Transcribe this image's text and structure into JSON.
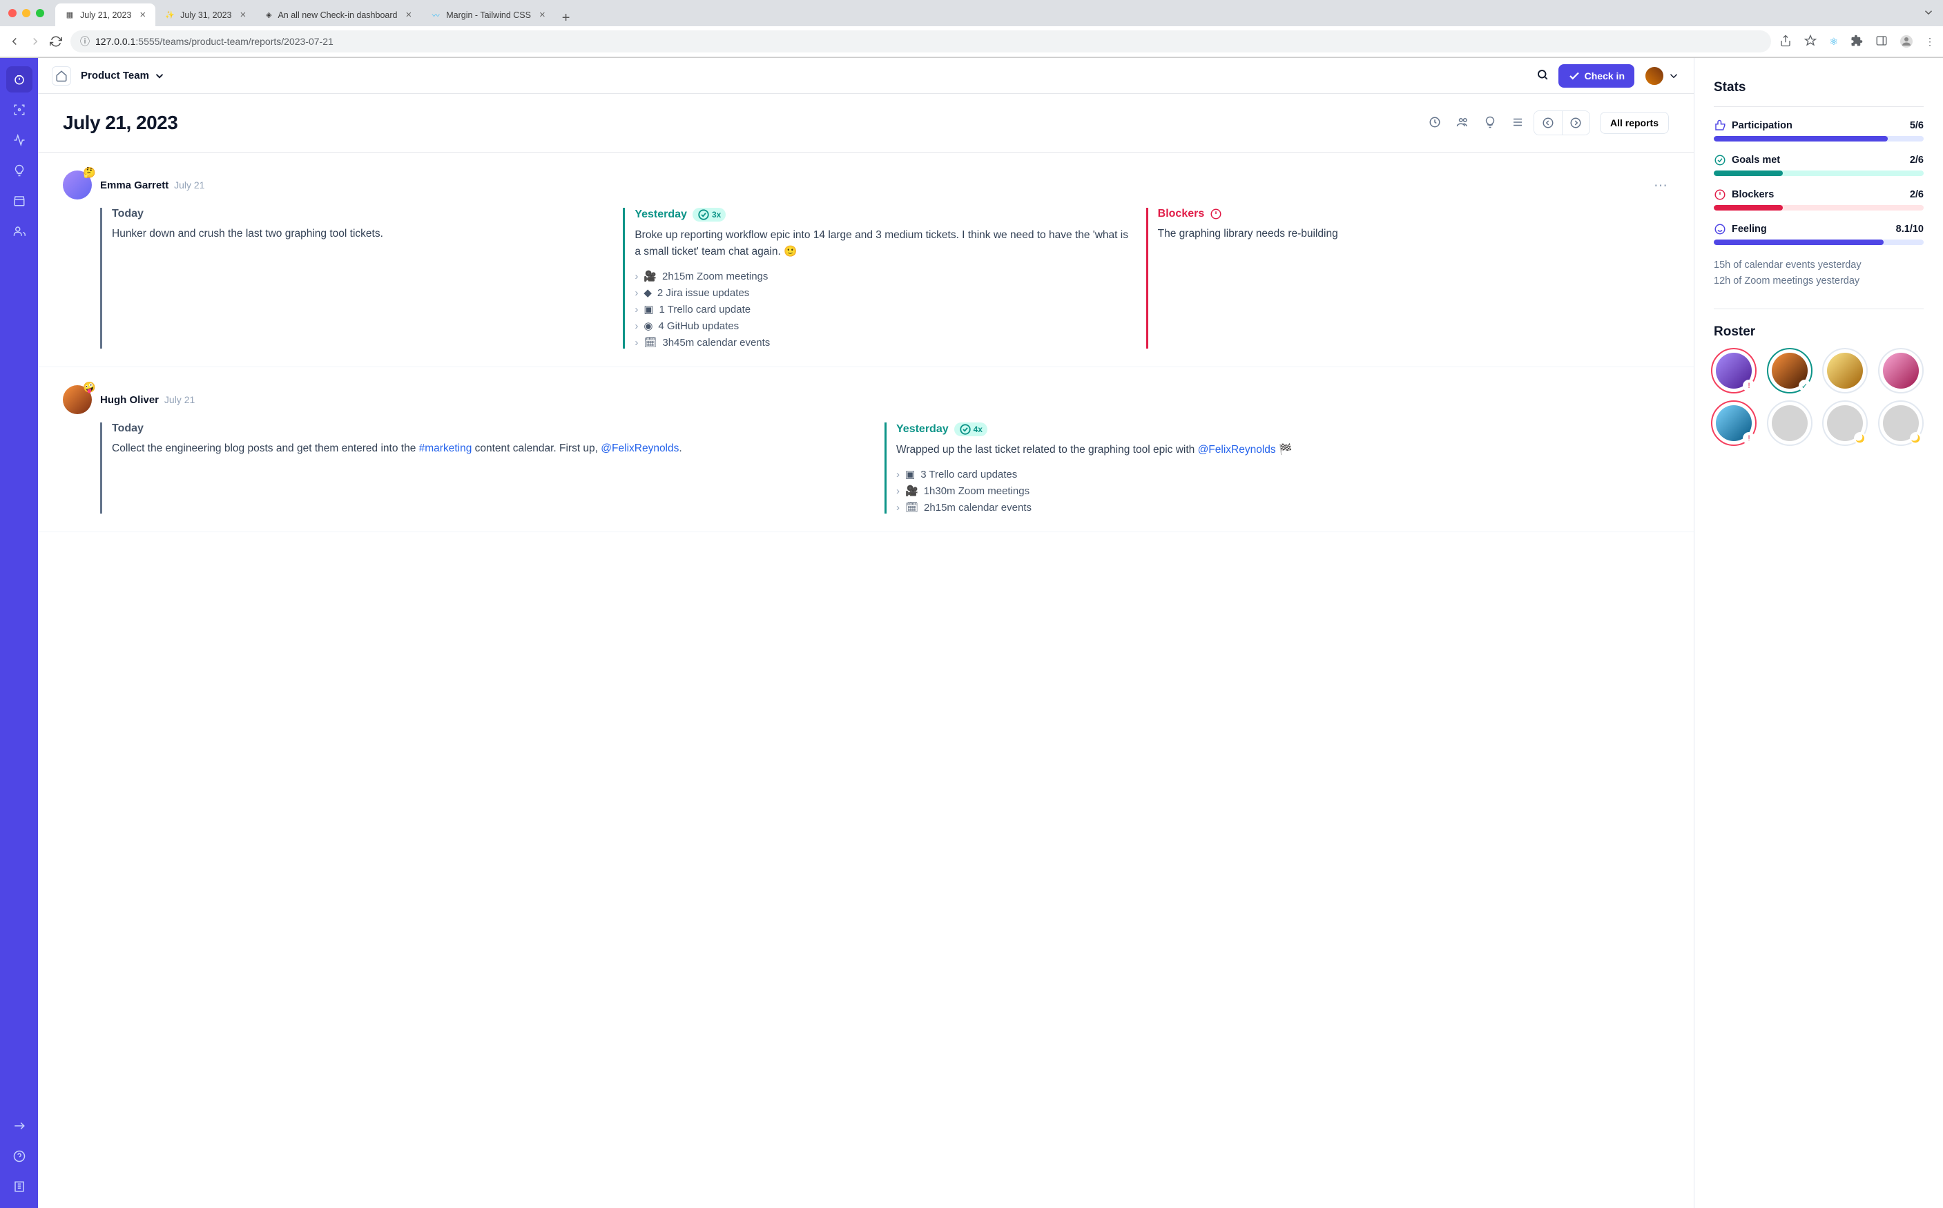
{
  "browser": {
    "tabs": [
      {
        "title": "July 21, 2023",
        "active": true
      },
      {
        "title": "July 31, 2023",
        "active": false
      },
      {
        "title": "An all new Check-in dashboard",
        "active": false
      },
      {
        "title": "Margin - Tailwind CSS",
        "active": false
      }
    ],
    "url_prefix": "127.0.0.1",
    "url_path": ":5555/teams/product-team/reports/2023-07-21"
  },
  "topbar": {
    "breadcrumb": "Product Team",
    "checkin_label": "Check in"
  },
  "header": {
    "title": "July 21, 2023",
    "all_reports_label": "All reports"
  },
  "reports": [
    {
      "name": "Emma Garrett",
      "date": "July 21",
      "emoji": "🤔",
      "today": "Hunker down and crush the last two graphing tool tickets.",
      "yesterday_chip": "3x",
      "yesterday": "Broke up reporting workflow epic into 14 large and 3 medium tickets. I think we need to have the 'what is a small ticket' team chat again. 🙂",
      "activities": [
        "2h15m Zoom meetings",
        "2 Jira issue updates",
        "1 Trello card update",
        "4 GitHub updates",
        "3h45m calendar events"
      ],
      "blockers_label": "Blockers",
      "blockers": "The graphing library needs re-building"
    },
    {
      "name": "Hugh Oliver",
      "date": "July 21",
      "emoji": "🤪",
      "today_pre": "Collect the engineering blog posts and get them entered into the ",
      "today_link1": "#marketing",
      "today_mid": " content calendar. First up, ",
      "today_link2": "@FelixReynolds",
      "today_post": ".",
      "yesterday_chip": "4x",
      "yesterday_pre": "Wrapped up the last ticket related to the graphing tool epic with ",
      "yesterday_link": "@FelixReynolds",
      "yesterday_post": " 🏁",
      "activities": [
        "3 Trello card updates",
        "1h30m Zoom meetings",
        "2h15m calendar events"
      ]
    }
  ],
  "labels": {
    "today": "Today",
    "yesterday": "Yesterday",
    "blockers": "Blockers"
  },
  "stats": {
    "heading": "Stats",
    "participation_label": "Participation",
    "participation_value": "5/6",
    "participation_pct": 83,
    "goals_label": "Goals met",
    "goals_value": "2/6",
    "goals_pct": 33,
    "blockers_label": "Blockers",
    "blockers_value": "2/6",
    "blockers_pct": 33,
    "feeling_label": "Feeling",
    "feeling_value": "8.1/10",
    "feeling_pct": 81,
    "meta1": "15h of calendar events yesterday",
    "meta2": "12h of Zoom meetings yesterday"
  },
  "roster": {
    "heading": "Roster"
  }
}
